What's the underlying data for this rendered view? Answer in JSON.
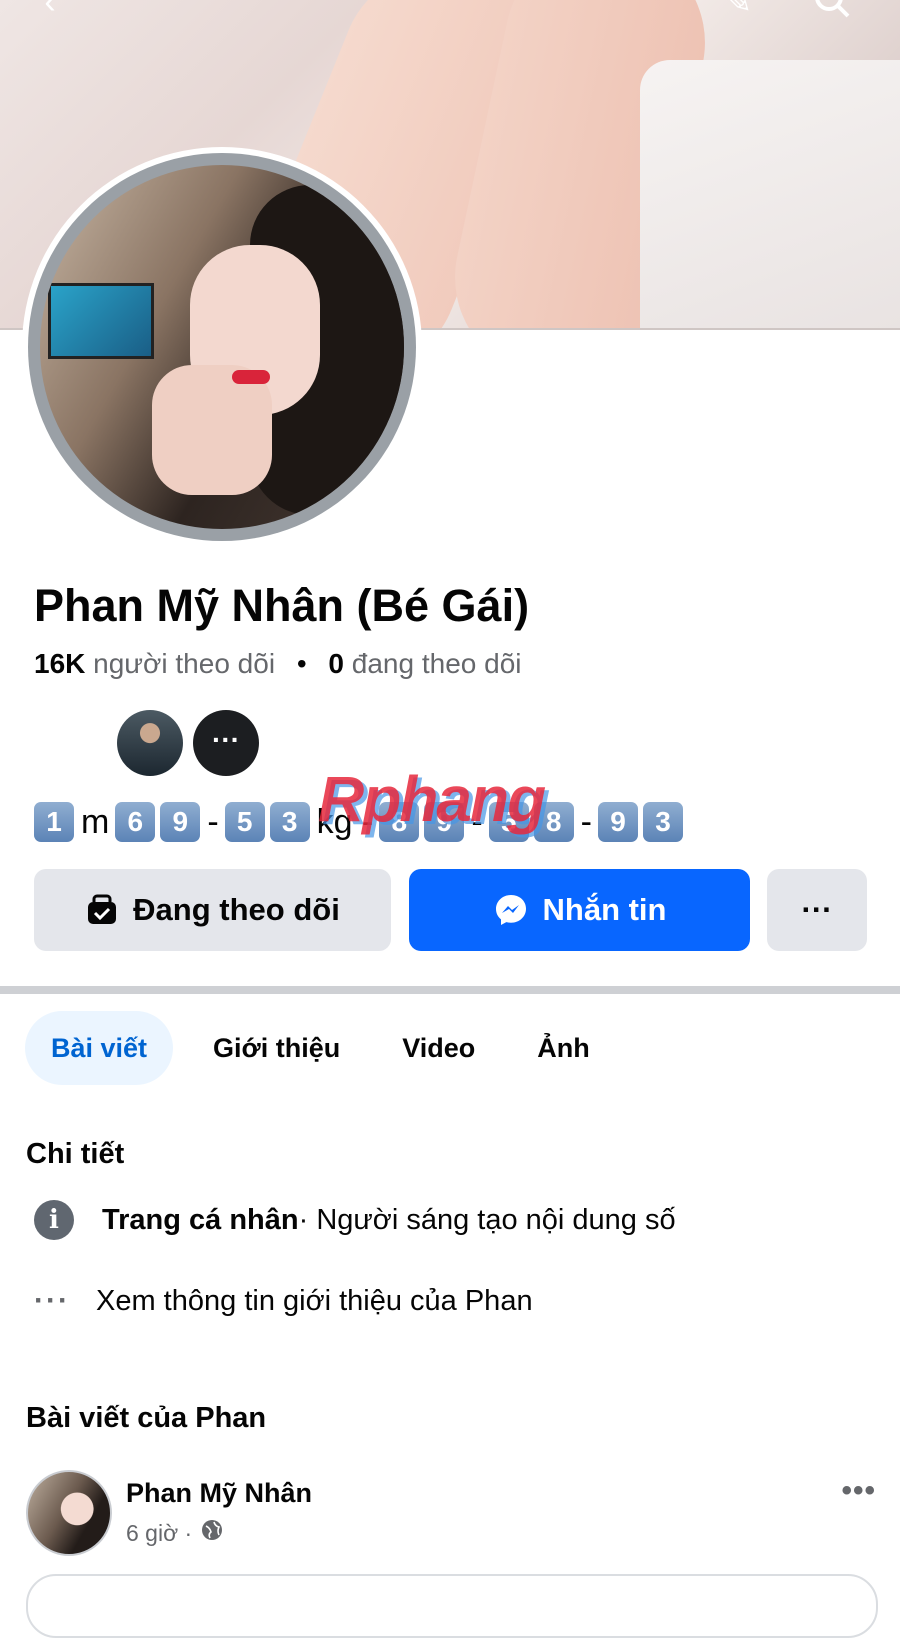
{
  "profile": {
    "name": "Phan Mỹ Nhân (Bé Gái)",
    "followers_count": "16K",
    "followers_label": "người theo dõi",
    "separator": "•",
    "following_count": "0",
    "following_label": "đang theo dõi"
  },
  "bio": [
    {
      "type": "key",
      "text": "1"
    },
    {
      "type": "text",
      "text": "m"
    },
    {
      "type": "key",
      "text": "6"
    },
    {
      "type": "key",
      "text": "9"
    },
    {
      "type": "text",
      "text": "-"
    },
    {
      "type": "key",
      "text": "5"
    },
    {
      "type": "key",
      "text": "3"
    },
    {
      "type": "text",
      "text": "kg -"
    },
    {
      "type": "key",
      "text": "8"
    },
    {
      "type": "key",
      "text": "9"
    },
    {
      "type": "text",
      "text": "-"
    },
    {
      "type": "key",
      "text": "5"
    },
    {
      "type": "key",
      "text": "8"
    },
    {
      "type": "text",
      "text": "-"
    },
    {
      "type": "key",
      "text": "9"
    },
    {
      "type": "key",
      "text": "3"
    }
  ],
  "watermark": "Rphang",
  "actions": {
    "following": "Đang theo dõi",
    "message": "Nhắn tin",
    "more": "···"
  },
  "tabs": [
    {
      "label": "Bài viết",
      "active": true
    },
    {
      "label": "Giới thiệu",
      "active": false
    },
    {
      "label": "Video",
      "active": false
    },
    {
      "label": "Ảnh",
      "active": false
    }
  ],
  "details": {
    "title": "Chi tiết",
    "profile_type_bold": "Trang cá nhân",
    "profile_type_rest": " · Người sáng tạo nội dung số",
    "see_about": "Xem thông tin giới thiệu của Phan"
  },
  "posts": {
    "title": "Bài viết của Phan",
    "author": "Phan Mỹ Nhân",
    "time": "6 giờ ·"
  },
  "colors": {
    "primary": "#0866ff",
    "tab_active_bg": "#ebf5ff",
    "tab_active_text": "#0064d1",
    "secondary_button": "#e4e6eb"
  },
  "icons": {
    "back": "chevron-left-icon",
    "edit": "pencil-icon",
    "search": "search-icon",
    "following": "follow-check-icon",
    "messenger": "messenger-icon",
    "info": "info-icon",
    "more": "more-dots-icon",
    "globe": "globe-icon"
  }
}
